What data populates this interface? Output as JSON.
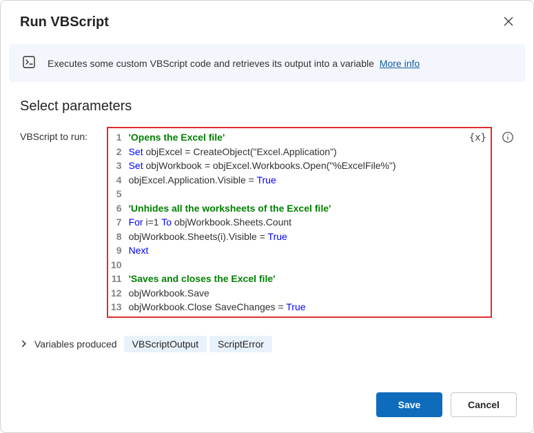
{
  "dialog": {
    "title": "Run VBScript",
    "close_icon": "close-icon"
  },
  "banner": {
    "text": "Executes some custom VBScript code and retrieves its output into a variable",
    "link_label": "More info"
  },
  "section": {
    "heading": "Select parameters",
    "param_label": "VBScript to run:",
    "fx_badge": "{x}"
  },
  "code": {
    "lines": [
      [
        [
          "cmt",
          "'Opens the Excel file'"
        ]
      ],
      [
        [
          "kw",
          "Set"
        ],
        [
          "txt",
          " objExcel = CreateObject(\"Excel.Application\")"
        ]
      ],
      [
        [
          "kw",
          "Set"
        ],
        [
          "txt",
          " objWorkbook = objExcel.Workbooks.Open(\"%ExcelFile%\")"
        ]
      ],
      [
        [
          "txt",
          "objExcel.Application.Visible = "
        ],
        [
          "lit",
          "True"
        ]
      ],
      [],
      [
        [
          "cmt",
          "'Unhides all the worksheets of the Excel file'"
        ]
      ],
      [
        [
          "kw",
          "For"
        ],
        [
          "txt",
          " i=1 "
        ],
        [
          "kw",
          "To"
        ],
        [
          "txt",
          " objWorkbook.Sheets.Count"
        ]
      ],
      [
        [
          "txt",
          "objWorkbook.Sheets(i).Visible = "
        ],
        [
          "lit",
          "True"
        ]
      ],
      [
        [
          "kw",
          "Next"
        ]
      ],
      [],
      [
        [
          "cmt",
          "'Saves and closes the Excel file'"
        ]
      ],
      [
        [
          "txt",
          "objWorkbook.Save"
        ]
      ],
      [
        [
          "txt",
          "objWorkbook.Close SaveChanges = "
        ],
        [
          "lit",
          "True"
        ]
      ]
    ]
  },
  "variables": {
    "label": "Variables produced",
    "pills": [
      "VBScriptOutput",
      "ScriptError"
    ]
  },
  "footer": {
    "primary": "Save",
    "secondary": "Cancel"
  }
}
